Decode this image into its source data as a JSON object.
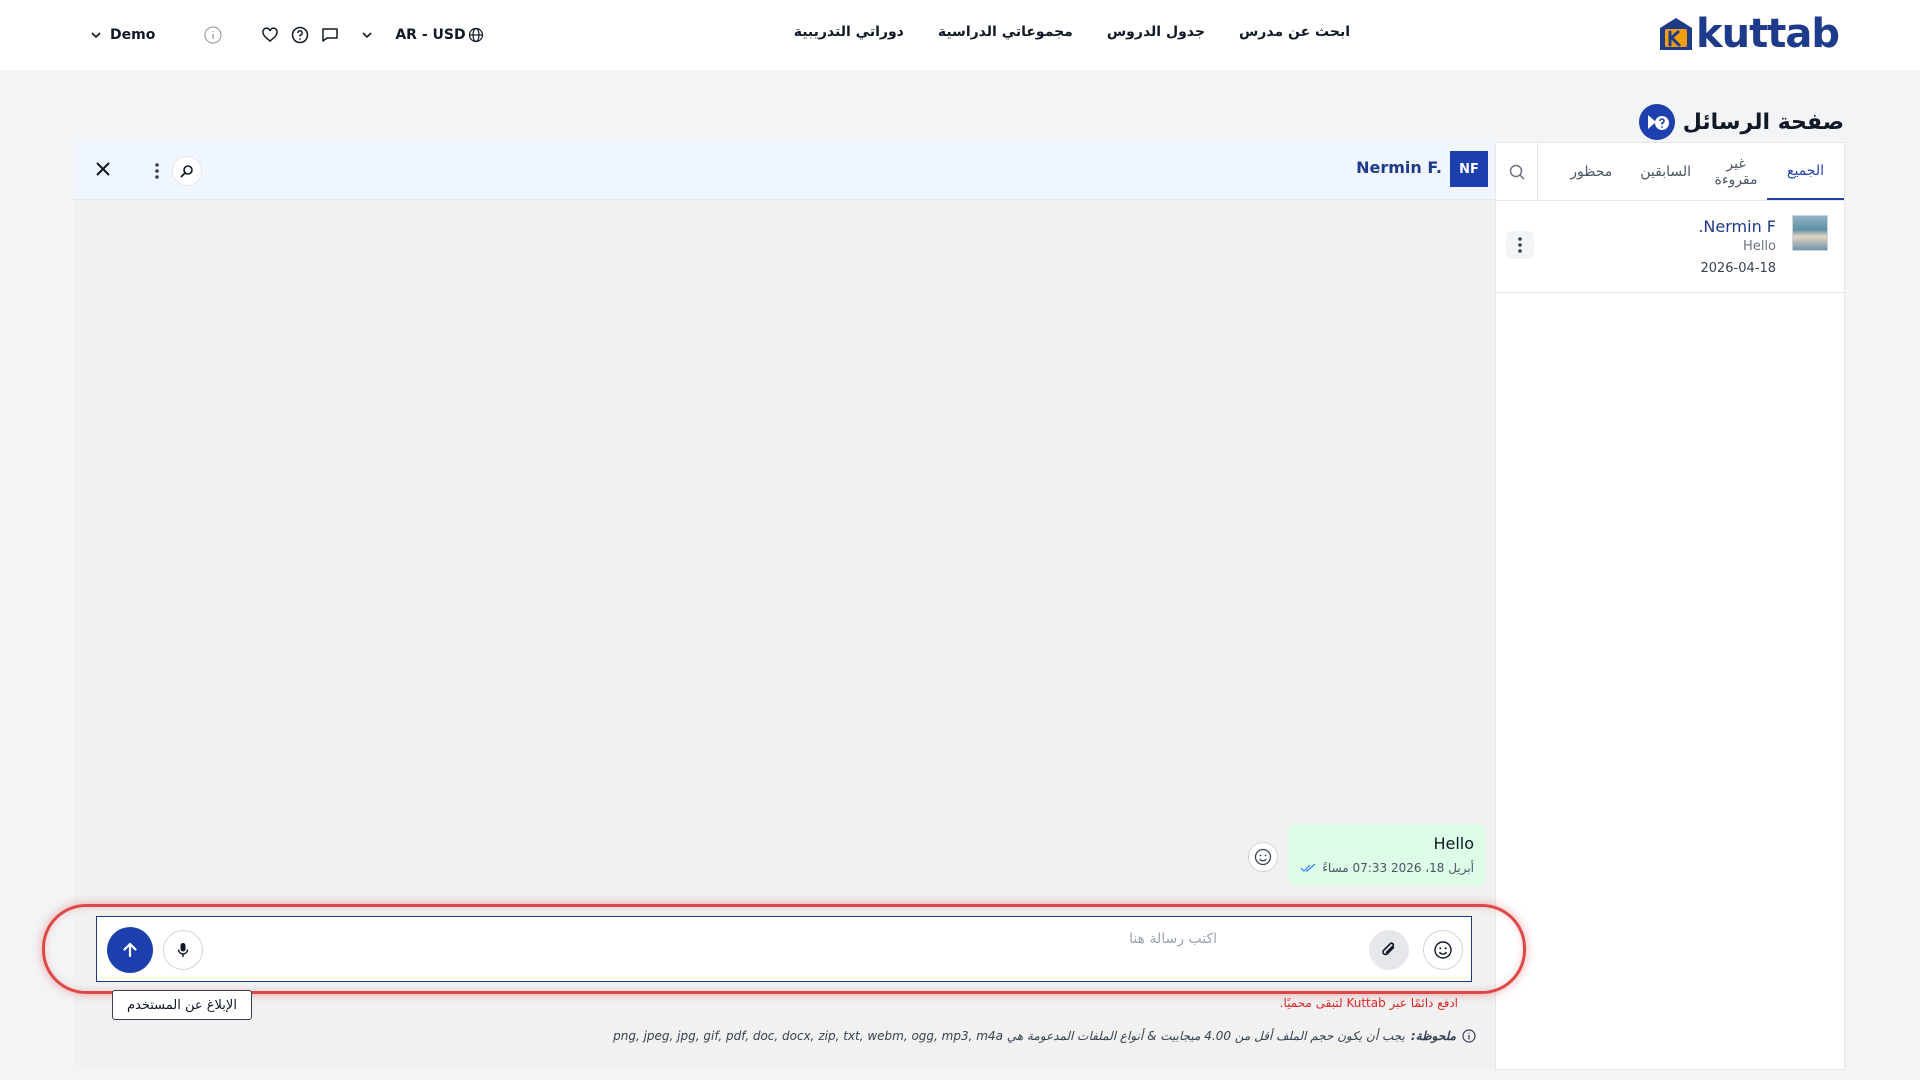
{
  "brand": {
    "logo_text": "kuttab",
    "logo_letter": "K"
  },
  "nav": {
    "links": [
      "ابحث عن مدرس",
      "جدول الدروس",
      "مجموعاتي الدراسية",
      "دوراتي التدريبية"
    ],
    "currency_label": "AR - USD",
    "user_label": "Demo"
  },
  "page": {
    "title": "صفحة الرسائل"
  },
  "conversations": {
    "tabs": [
      {
        "label": "الجميع",
        "active": true
      },
      {
        "label": "غير مقروءة",
        "active": false
      },
      {
        "label": "السابقين",
        "active": false
      },
      {
        "label": "محظور",
        "active": false
      }
    ],
    "items": [
      {
        "name": "Nermin F.",
        "preview": "Hello",
        "date": "2026-04-18"
      }
    ]
  },
  "chat": {
    "header": {
      "initials": "NF",
      "name": "Nermin F."
    },
    "messages": [
      {
        "text": "Hello",
        "time": "أبريل 18، 2026 07:33 مساءً",
        "status": "read"
      }
    ],
    "composer": {
      "placeholder": "اكتب رسالة هنا",
      "value": ""
    },
    "report_label": "الإبلاغ عن المستخدم",
    "safety_note": "ادفع دائمًا عبر Kuttab لتبقى محميًا.",
    "file_note_label": "ملحوظة:",
    "file_note_text": "يجب أن يكون حجم الملف أقل من 4.00 ميجابيت & أنواع الملفات المدعومة هي png, jpeg, jpg, gif, pdf, doc, docx, zip, txt, webm, ogg, mp3, m4a"
  },
  "colors": {
    "accent": "#1e40af",
    "sent_bubble": "#dcfce7",
    "highlight": "#dc4848",
    "header_bg": "#eff6ff"
  }
}
